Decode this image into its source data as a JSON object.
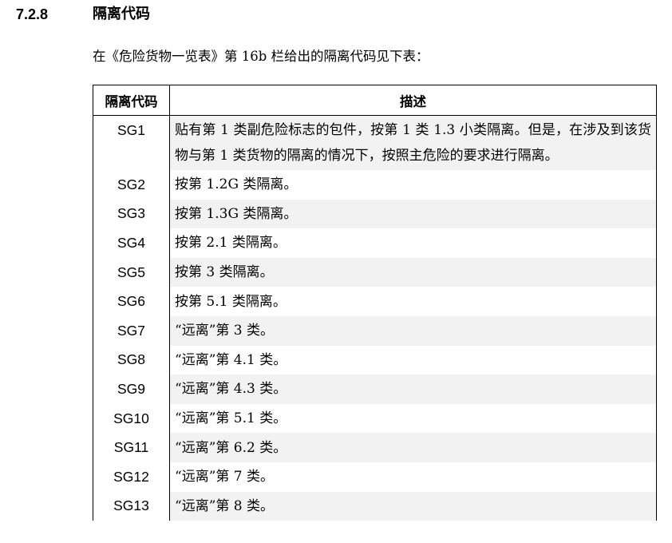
{
  "section": {
    "number": "7.2.8",
    "title": "隔离代码"
  },
  "intro": "在《危险货物一览表》第 16b 栏给出的隔离代码见下表：",
  "table": {
    "headers": [
      "隔离代码",
      "描述"
    ],
    "rows": [
      {
        "code": "SG1",
        "description": "贴有第 1 类副危险标志的包件，按第 1 类 1.3 小类隔离。但是，在涉及到该货物与第 1 类货物的隔离的情况下，按照主危险的要求进行隔离。"
      },
      {
        "code": "SG2",
        "description": "按第 1.2G 类隔离。"
      },
      {
        "code": "SG3",
        "description": "按第 1.3G 类隔离。"
      },
      {
        "code": "SG4",
        "description": "按第 2.1 类隔离。"
      },
      {
        "code": "SG5",
        "description": "按第 3 类隔离。"
      },
      {
        "code": "SG6",
        "description": "按第 5.1 类隔离。"
      },
      {
        "code": "SG7",
        "description": "“远离”第 3 类。"
      },
      {
        "code": "SG8",
        "description": "“远离”第 4.1 类。"
      },
      {
        "code": "SG9",
        "description": "“远离”第 4.3 类。"
      },
      {
        "code": "SG10",
        "description": "“远离”第 5.1 类。"
      },
      {
        "code": "SG11",
        "description": "“远离”第 6.2 类。"
      },
      {
        "code": "SG12",
        "description": "“远离”第 7 类。"
      },
      {
        "code": "SG13",
        "description": "“远离”第 8 类。"
      }
    ]
  },
  "colors": {
    "text": "#000000",
    "row_shading": "#f2f2f2",
    "border": "#000000"
  }
}
